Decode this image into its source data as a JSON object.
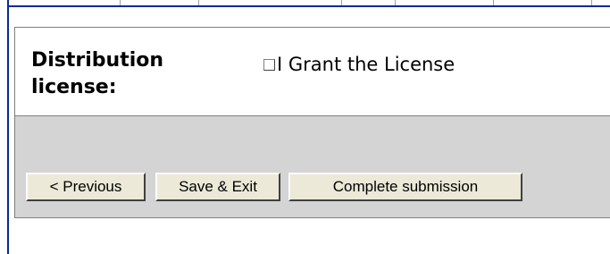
{
  "license": {
    "label": "Distribution license:",
    "checkbox_label": "I Grant the License",
    "checked": false
  },
  "buttons": {
    "previous": "< Previous",
    "save_exit": "Save & Exit",
    "complete": "Complete submission"
  },
  "colors": {
    "frame_border": "#0a2a9a",
    "button_bar_bg": "#d4d4d4",
    "button_bg": "#ece9d8"
  }
}
